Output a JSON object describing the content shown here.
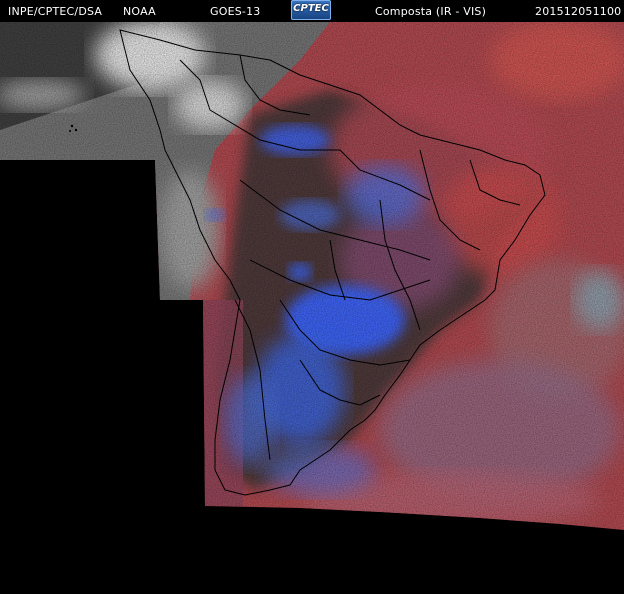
{
  "header": {
    "institution": "INPE/CPTEC/DSA",
    "agency": "NOAA",
    "satellite": "GOES-13",
    "logo": "CPTEC",
    "product": "Composta (IR - VIS)",
    "timestamp": "201512051100"
  },
  "colors": {
    "background": "#000000",
    "vis_gray": "#8a8a8a",
    "ir_red": "#b2494f",
    "cold_cloud_blue": "#3f66e8",
    "land_dark": "#343434",
    "boundaries": "#000000"
  }
}
